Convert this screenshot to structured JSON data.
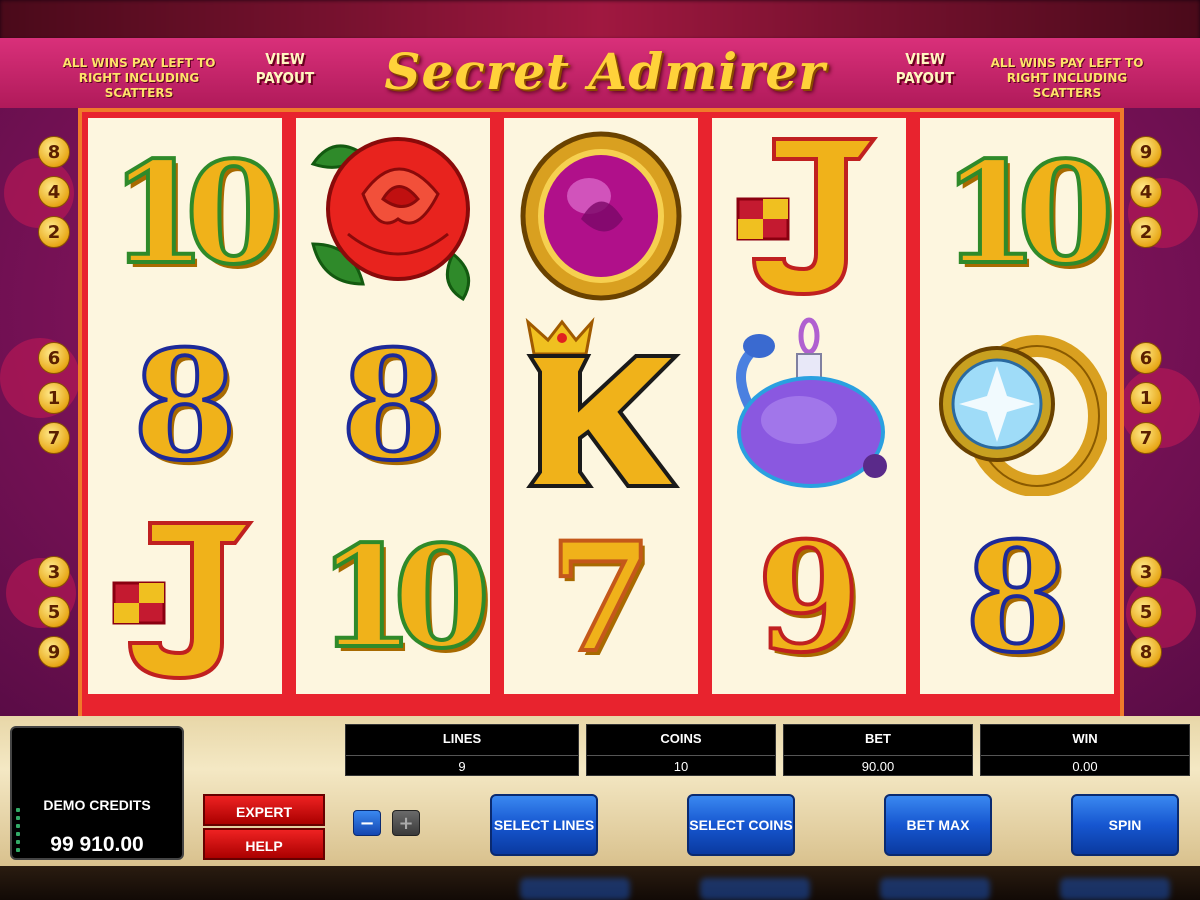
{
  "header": {
    "title": "Secret Admirer",
    "note_left": "ALL WINS PAY LEFT TO RIGHT INCLUDING SCATTERS",
    "note_right": "ALL WINS PAY LEFT TO RIGHT INCLUDING SCATTERS",
    "view_payout_left": "VIEW PAYOUT",
    "view_payout_right": "VIEW PAYOUT"
  },
  "reels": [
    [
      "10",
      "8",
      "J"
    ],
    [
      "rose",
      "8",
      "10"
    ],
    [
      "locket",
      "K",
      "7"
    ],
    [
      "J",
      "perfume",
      "9"
    ],
    [
      "10",
      "diamond-ring",
      "8"
    ]
  ],
  "paylines": {
    "left": [
      "8",
      "4",
      "2",
      "6",
      "1",
      "7",
      "3",
      "5",
      "9"
    ],
    "right": [
      "9",
      "4",
      "2",
      "6",
      "1",
      "7",
      "3",
      "5",
      "8"
    ]
  },
  "credits": {
    "label": "DEMO CREDITS",
    "value": "99 910.00"
  },
  "buttons": {
    "expert": "EXPERT",
    "help": "HELP",
    "minus": "−",
    "plus": "+",
    "select_lines": "SELECT LINES",
    "select_coins": "SELECT COINS",
    "bet_max": "BET MAX",
    "spin": "SPIN"
  },
  "stats": {
    "lines_label": "LINES",
    "lines_value": "9",
    "coins_label": "COINS",
    "coins_value": "10",
    "bet_label": "BET",
    "bet_value": "90.00",
    "win_label": "WIN",
    "win_value": "0.00"
  },
  "colors": {
    "reel_border": "#e8232e",
    "symbol_gold": "#f0b21a",
    "button_blue": "#1656d0",
    "button_red": "#cc1111"
  }
}
